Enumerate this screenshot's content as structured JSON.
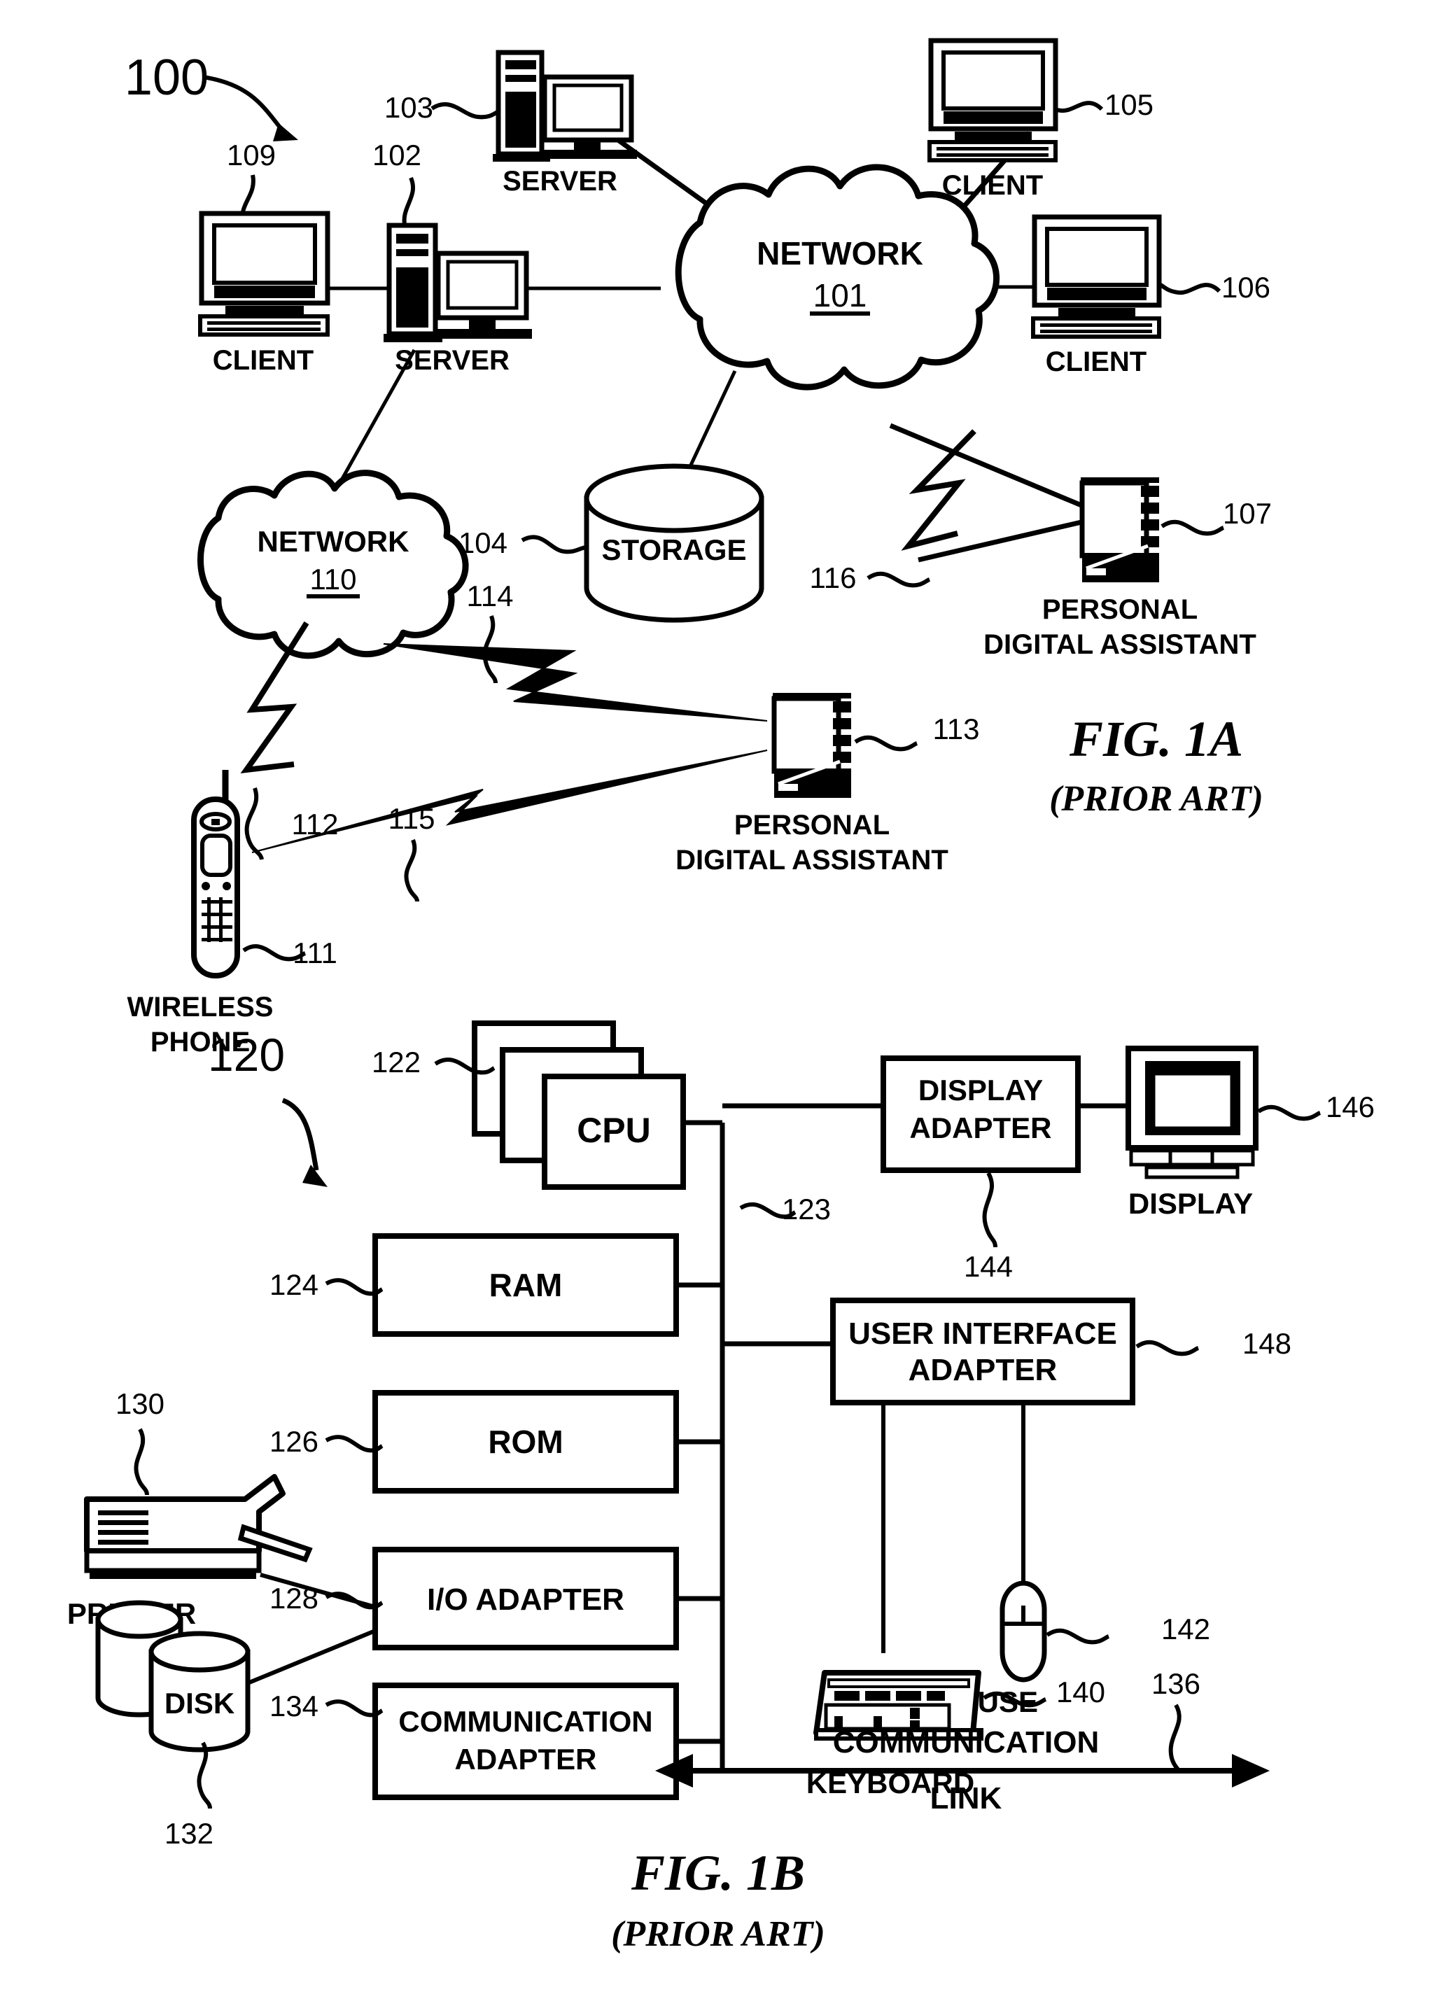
{
  "sheet": {
    "background": "#ffffff",
    "ink": "#000000"
  },
  "figures": [
    {
      "id": "fig-1a",
      "caption": "FIG. 1A",
      "subcaption": "(PRIOR ART)",
      "system_number": "100"
    },
    {
      "id": "fig-1b",
      "caption": "FIG. 1B",
      "subcaption": "(PRIOR ART)",
      "system_number": "120"
    }
  ],
  "fig1a": {
    "system_number": "100",
    "nodes": {
      "client_109": {
        "label": "CLIENT",
        "ref": "109"
      },
      "server_102": {
        "label": "SERVER",
        "ref": "102"
      },
      "server_103": {
        "label": "SERVER",
        "ref": "103"
      },
      "client_105": {
        "label": "CLIENT",
        "ref": "105"
      },
      "client_106": {
        "label": "CLIENT",
        "ref": "106"
      },
      "network_101": {
        "label": "NETWORK",
        "ref": "101"
      },
      "network_110": {
        "label": "NETWORK",
        "ref": "110"
      },
      "storage_104": {
        "label": "STORAGE",
        "ref": "104"
      },
      "pda_107": {
        "label_line1": "PERSONAL",
        "label_line2": "DIGITAL ASSISTANT",
        "ref": "107"
      },
      "pda_113": {
        "label_line1": "PERSONAL",
        "label_line2": "DIGITAL ASSISTANT",
        "ref": "113"
      },
      "phone_111": {
        "label_line1": "WIRELESS",
        "label_line2": "PHONE",
        "ref": "111"
      }
    },
    "wireless_links": [
      {
        "ref": "112"
      },
      {
        "ref": "114"
      },
      {
        "ref": "115"
      },
      {
        "ref": "116"
      }
    ]
  },
  "fig1b": {
    "system_number": "120",
    "blocks": {
      "cpu": {
        "label": "CPU",
        "ref": "122"
      },
      "ram": {
        "label": "RAM",
        "ref": "124"
      },
      "rom": {
        "label": "ROM",
        "ref": "126"
      },
      "io_adapter": {
        "label": "I/O ADAPTER",
        "ref": "128"
      },
      "communication_adapter": {
        "label_line1": "COMMUNICATION",
        "label_line2": "ADAPTER",
        "ref": "134"
      },
      "display_adapter": {
        "label_line1": "DISPLAY",
        "label_line2": "ADAPTER",
        "ref": "144"
      },
      "user_interface_adapter": {
        "label_line1": "USER INTERFACE",
        "label_line2": "ADAPTER",
        "ref": "148"
      }
    },
    "peripherals": {
      "display": {
        "label": "DISPLAY",
        "ref": "146"
      },
      "mouse": {
        "label": "MOUSE",
        "ref": "142"
      },
      "keyboard": {
        "label": "KEYBOARD",
        "ref": "140"
      },
      "printer": {
        "label": "PRINTER",
        "ref": "130"
      },
      "disk": {
        "label": "DISK",
        "ref": "132"
      }
    },
    "bus": {
      "ref": "123"
    },
    "communication_link": {
      "label_line1": "COMMUNICATION",
      "label_line2": "LINK",
      "ref": "136"
    }
  }
}
